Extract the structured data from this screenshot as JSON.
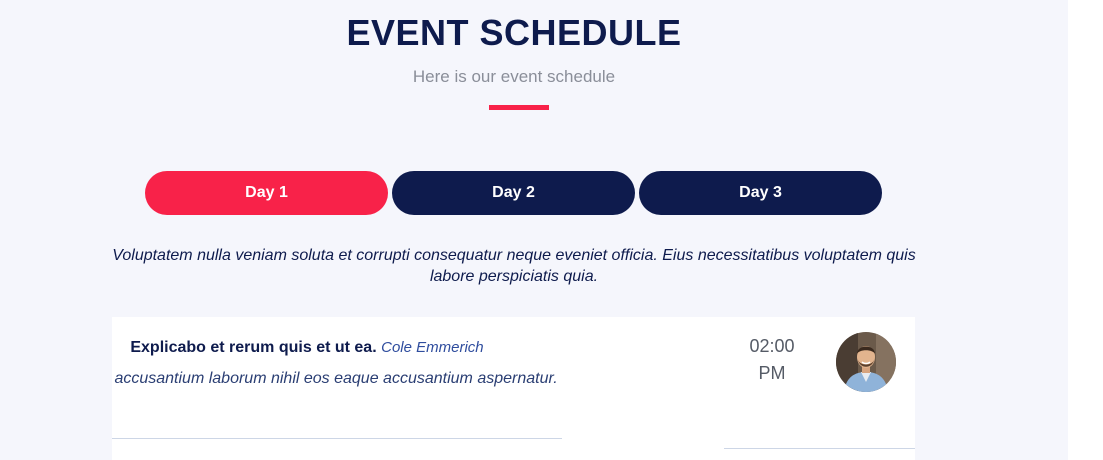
{
  "header": {
    "title": "EVENT SCHEDULE",
    "subtitle": "Here is our event schedule"
  },
  "tabs": [
    {
      "label": "Day 1",
      "active": true
    },
    {
      "label": "Day 2",
      "active": false
    },
    {
      "label": "Day 3",
      "active": false
    }
  ],
  "intro_text": "Voluptatem nulla veniam soluta et corrupti consequatur neque eveniet officia. Eius necessitatibus voluptatem quis labore perspiciatis quia.",
  "schedule": [
    {
      "time": "02:00 PM",
      "title": "Explicabo et rerum quis et ut ea.",
      "speaker": "Cole Emmerich",
      "description": "Veniam accusantium laborum nihil eos eaque accusantium aspernatur."
    }
  ],
  "colors": {
    "accent": "#f82249",
    "navy": "#0e1b4d",
    "background": "#f5f6fc"
  }
}
